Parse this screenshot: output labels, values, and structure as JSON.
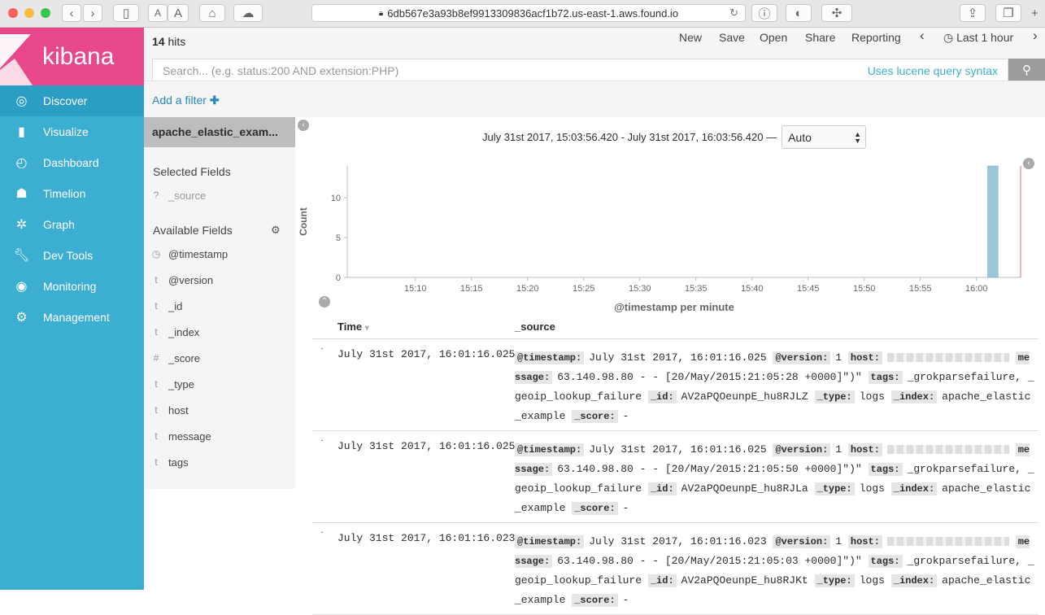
{
  "browser": {
    "url": "6db567e3a93b8ef9913309836acf1b72.us-east-1.aws.found.io",
    "font_small": "A",
    "font_large": "A"
  },
  "brand": {
    "name": "kibana",
    "color": "#e8488b"
  },
  "nav": [
    {
      "label": "Discover",
      "icon": "compass-icon",
      "active": true
    },
    {
      "label": "Visualize",
      "icon": "bar-chart-icon"
    },
    {
      "label": "Dashboard",
      "icon": "dashboard-icon"
    },
    {
      "label": "Timelion",
      "icon": "timelion-icon"
    },
    {
      "label": "Graph",
      "icon": "graph-icon"
    },
    {
      "label": "Dev Tools",
      "icon": "wrench-icon"
    },
    {
      "label": "Monitoring",
      "icon": "eye-icon"
    },
    {
      "label": "Management",
      "icon": "gear-icon"
    }
  ],
  "top": {
    "hits_count": "14",
    "hits_label": "hits",
    "menu": [
      "New",
      "Save",
      "Open",
      "Share",
      "Reporting"
    ],
    "time_label": "Last 1 hour",
    "search_placeholder": "Search... (e.g. status:200 AND extension:PHP)",
    "lucene": "Uses lucene query syntax",
    "add_filter": "Add a filter"
  },
  "fields": {
    "index": "apache_elastic_exam...",
    "selected_title": "Selected Fields",
    "selected": [
      {
        "type": "?",
        "name": "_source"
      }
    ],
    "available_title": "Available Fields",
    "available": [
      {
        "type": "◷",
        "name": "@timestamp"
      },
      {
        "type": "t",
        "name": "@version"
      },
      {
        "type": "t",
        "name": "_id"
      },
      {
        "type": "t",
        "name": "_index"
      },
      {
        "type": "#",
        "name": "_score"
      },
      {
        "type": "t",
        "name": "_type"
      },
      {
        "type": "t",
        "name": "host"
      },
      {
        "type": "t",
        "name": "message"
      },
      {
        "type": "t",
        "name": "tags"
      }
    ]
  },
  "histogram": {
    "range": "July 31st 2017, 15:03:56.420 - July 31st 2017, 16:03:56.420 —",
    "interval": "Auto",
    "ylabel": "Count",
    "xlabel": "@timestamp per minute",
    "bar_color": "#9ac6d8"
  },
  "chart_data": {
    "type": "bar",
    "x": [
      "16:01"
    ],
    "values": [
      14
    ],
    "xticks": [
      "15:10",
      "15:15",
      "15:20",
      "15:25",
      "15:30",
      "15:35",
      "15:40",
      "15:45",
      "15:50",
      "15:55",
      "16:00"
    ],
    "yticks": [
      "0",
      "5",
      "10"
    ],
    "ylim": [
      0,
      14
    ],
    "ylabel": "Count",
    "xlabel": "@timestamp per minute"
  },
  "table": {
    "col_time": "Time",
    "col_source": "_source",
    "rows": [
      {
        "time": "July 31st 2017, 16:01:16.025",
        "timestamp": "July 31st 2017, 16:01:16.025",
        "version": "1",
        "message": "63.140.98.80 - - [20/May/2015:21:05:28 +0000]\")\"",
        "tags": "_grokparsefailure, _geoip_lookup_failure",
        "id": "AV2aPQOeunpE_hu8RJLZ",
        "type": "logs",
        "index": "apache_elastic_example",
        "score": "-"
      },
      {
        "time": "July 31st 2017, 16:01:16.025",
        "timestamp": "July 31st 2017, 16:01:16.025",
        "version": "1",
        "message": "63.140.98.80 - - [20/May/2015:21:05:50 +0000]\")\"",
        "tags": "_grokparsefailure, _geoip_lookup_failure",
        "id": "AV2aPQOeunpE_hu8RJLa",
        "type": "logs",
        "index": "apache_elastic_example",
        "score": "-"
      },
      {
        "time": "July 31st 2017, 16:01:16.023",
        "timestamp": "July 31st 2017, 16:01:16.023",
        "version": "1",
        "message": "63.140.98.80 - - [20/May/2015:21:05:03 +0000]\")\"",
        "tags": "_grokparsefailure, _geoip_lookup_failure",
        "id": "AV2aPQOeunpE_hu8RJKt",
        "type": "logs",
        "index": "apache_elastic_example",
        "score": "-"
      }
    ]
  }
}
